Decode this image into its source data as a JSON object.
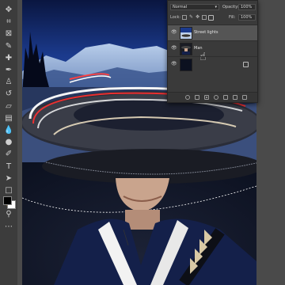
{
  "tools": [
    {
      "icon": "move-icon",
      "glyph": "✥"
    },
    {
      "icon": "crop-icon",
      "glyph": "⌗"
    },
    {
      "icon": "frame-icon",
      "glyph": "⊠"
    },
    {
      "icon": "eyedropper-icon",
      "glyph": "✎"
    },
    {
      "icon": "healing-brush-icon",
      "glyph": "✚"
    },
    {
      "icon": "brush-icon",
      "glyph": "✒"
    },
    {
      "icon": "clone-stamp-icon",
      "glyph": "♙"
    },
    {
      "icon": "history-brush-icon",
      "glyph": "↺"
    },
    {
      "icon": "eraser-icon",
      "glyph": "▱"
    },
    {
      "icon": "gradient-icon",
      "glyph": "▤"
    },
    {
      "icon": "blur-icon",
      "glyph": "💧"
    },
    {
      "icon": "dodge-icon",
      "glyph": "●"
    },
    {
      "icon": "pen-icon",
      "glyph": "✐"
    },
    {
      "icon": "type-icon",
      "glyph": "T"
    },
    {
      "icon": "path-selection-icon",
      "glyph": "➤"
    },
    {
      "icon": "rectangle-icon",
      "glyph": "□"
    },
    {
      "icon": "hand-icon",
      "glyph": "✋"
    },
    {
      "icon": "zoom-icon",
      "glyph": "⚲"
    },
    {
      "icon": "more-tools-icon",
      "glyph": "⋯"
    }
  ],
  "colors": {
    "foreground": "#000000",
    "background": "#ffffff"
  },
  "layers_panel": {
    "blend_mode": "Normal",
    "opacity_label": "Opacity:",
    "opacity_value": "100%",
    "lock_label": "Lock:",
    "fill_label": "Fill:",
    "fill_value": "100%",
    "layers": [
      {
        "name": "Street lights",
        "selected": true,
        "thumb": "landscape"
      },
      {
        "name": "Man",
        "selected": false,
        "thumb": "person"
      },
      {
        "name": "",
        "selected": false,
        "thumb": "dark",
        "locked": true
      }
    ]
  }
}
